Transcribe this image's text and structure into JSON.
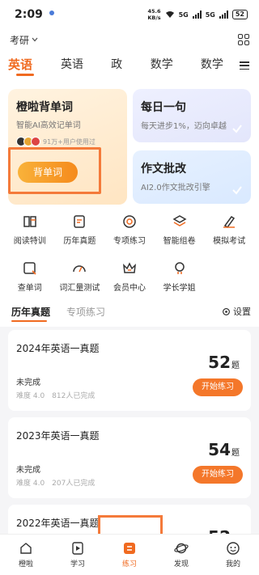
{
  "status": {
    "time": "2:09",
    "net_speed_top": "45.6",
    "net_speed_bottom": "KB/s",
    "sig1": "5G",
    "sig2": "5G",
    "battery": "52"
  },
  "topbar": {
    "exam_type": "考研"
  },
  "subject_tabs": [
    "英语一",
    "英语二",
    "政治",
    "数学一",
    "数学二"
  ],
  "featured": {
    "vocab": {
      "title": "橙啦背单词",
      "subtitle": "智能AI高效记单词",
      "users": "91万+用户使用过",
      "button": "背单词"
    },
    "daily": {
      "title": "每日一句",
      "subtitle": "每天进步1%，迈向卓越"
    },
    "essay": {
      "title": "作文批改",
      "subtitle": "AI2.0作文批改引擎"
    }
  },
  "tools": [
    {
      "label": "阅读特训",
      "icon": "book-icon"
    },
    {
      "label": "历年真题",
      "icon": "document-icon"
    },
    {
      "label": "专项练习",
      "icon": "target-icon"
    },
    {
      "label": "智能组卷",
      "icon": "layers-icon"
    },
    {
      "label": "模拟考试",
      "icon": "pencil-icon"
    },
    {
      "label": "查单词",
      "icon": "search-word-icon"
    },
    {
      "label": "词汇量测试",
      "icon": "gauge-icon"
    },
    {
      "label": "会员中心",
      "icon": "crown-icon"
    },
    {
      "label": "学长学姐",
      "icon": "person-icon"
    }
  ],
  "section_tabs": {
    "past_papers": "历年真题",
    "special": "专项练习",
    "settings": "设置"
  },
  "exams": [
    {
      "title": "2024年英语一真题",
      "count": "52",
      "unit": "题",
      "status": "未完成",
      "meta": "难度 4.0　812人已完成",
      "button": "开始练习"
    },
    {
      "title": "2023年英语一真题",
      "count": "54",
      "unit": "题",
      "status": "未完成",
      "meta": "难度 4.0　207人已完成",
      "button": "开始练习"
    },
    {
      "title": "2022年英语一真题",
      "count": "52",
      "unit": "题",
      "status": "",
      "meta": "",
      "button": ""
    }
  ],
  "nav": [
    "橙啦",
    "学习",
    "练习",
    "发现",
    "我的"
  ],
  "colors": {
    "accent": "#f06a20",
    "button": "#f4772a",
    "highlight": "#f47a3a"
  }
}
